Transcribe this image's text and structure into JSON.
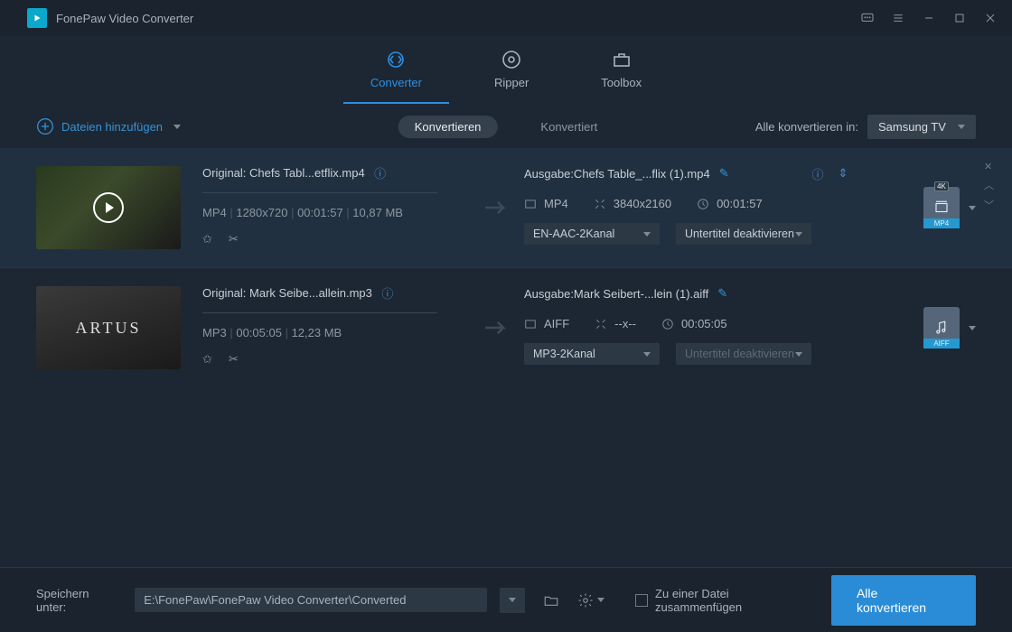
{
  "app": {
    "title": "FonePaw Video Converter"
  },
  "tabs": [
    {
      "label": "Converter",
      "active": true
    },
    {
      "label": "Ripper",
      "active": false
    },
    {
      "label": "Toolbox",
      "active": false
    }
  ],
  "toolbar": {
    "add_files": "Dateien hinzufügen",
    "pill_convert": "Konvertieren",
    "pill_converted": "Konvertiert",
    "convert_all_to": "Alle konvertieren in:",
    "format_selected": "Samsung TV"
  },
  "files": [
    {
      "original_label": "Original: Chefs Tabl...etflix.mp4",
      "src_format": "MP4",
      "src_res": "1280x720",
      "src_dur": "00:01:57",
      "src_size": "10,87 MB",
      "output_label": "Ausgabe:Chefs Table_...flix (1).mp4",
      "dst_format": "MP4",
      "dst_res": "3840x2160",
      "dst_dur": "00:01:57",
      "audio_sel": "EN-AAC-2Kanal",
      "sub_sel": "Untertitel deaktivieren",
      "badge_top": "4K",
      "badge_label": "MP4"
    },
    {
      "original_label": "Original: Mark Seibe...allein.mp3",
      "src_format": "MP3",
      "src_res": "",
      "src_dur": "00:05:05",
      "src_size": "12,23 MB",
      "output_label": "Ausgabe:Mark Seibert-...lein (1).aiff",
      "dst_format": "AIFF",
      "dst_res": "--x--",
      "dst_dur": "00:05:05",
      "audio_sel": "MP3-2Kanal",
      "sub_sel": "Untertitel deaktivieren",
      "badge_top": "",
      "badge_label": "AIFF"
    }
  ],
  "footer": {
    "save_label": "Speichern unter:",
    "save_path": "E:\\FonePaw\\FonePaw Video Converter\\Converted",
    "merge_label": "Zu einer Datei zusammenfügen",
    "convert_all": "Alle konvertieren"
  }
}
